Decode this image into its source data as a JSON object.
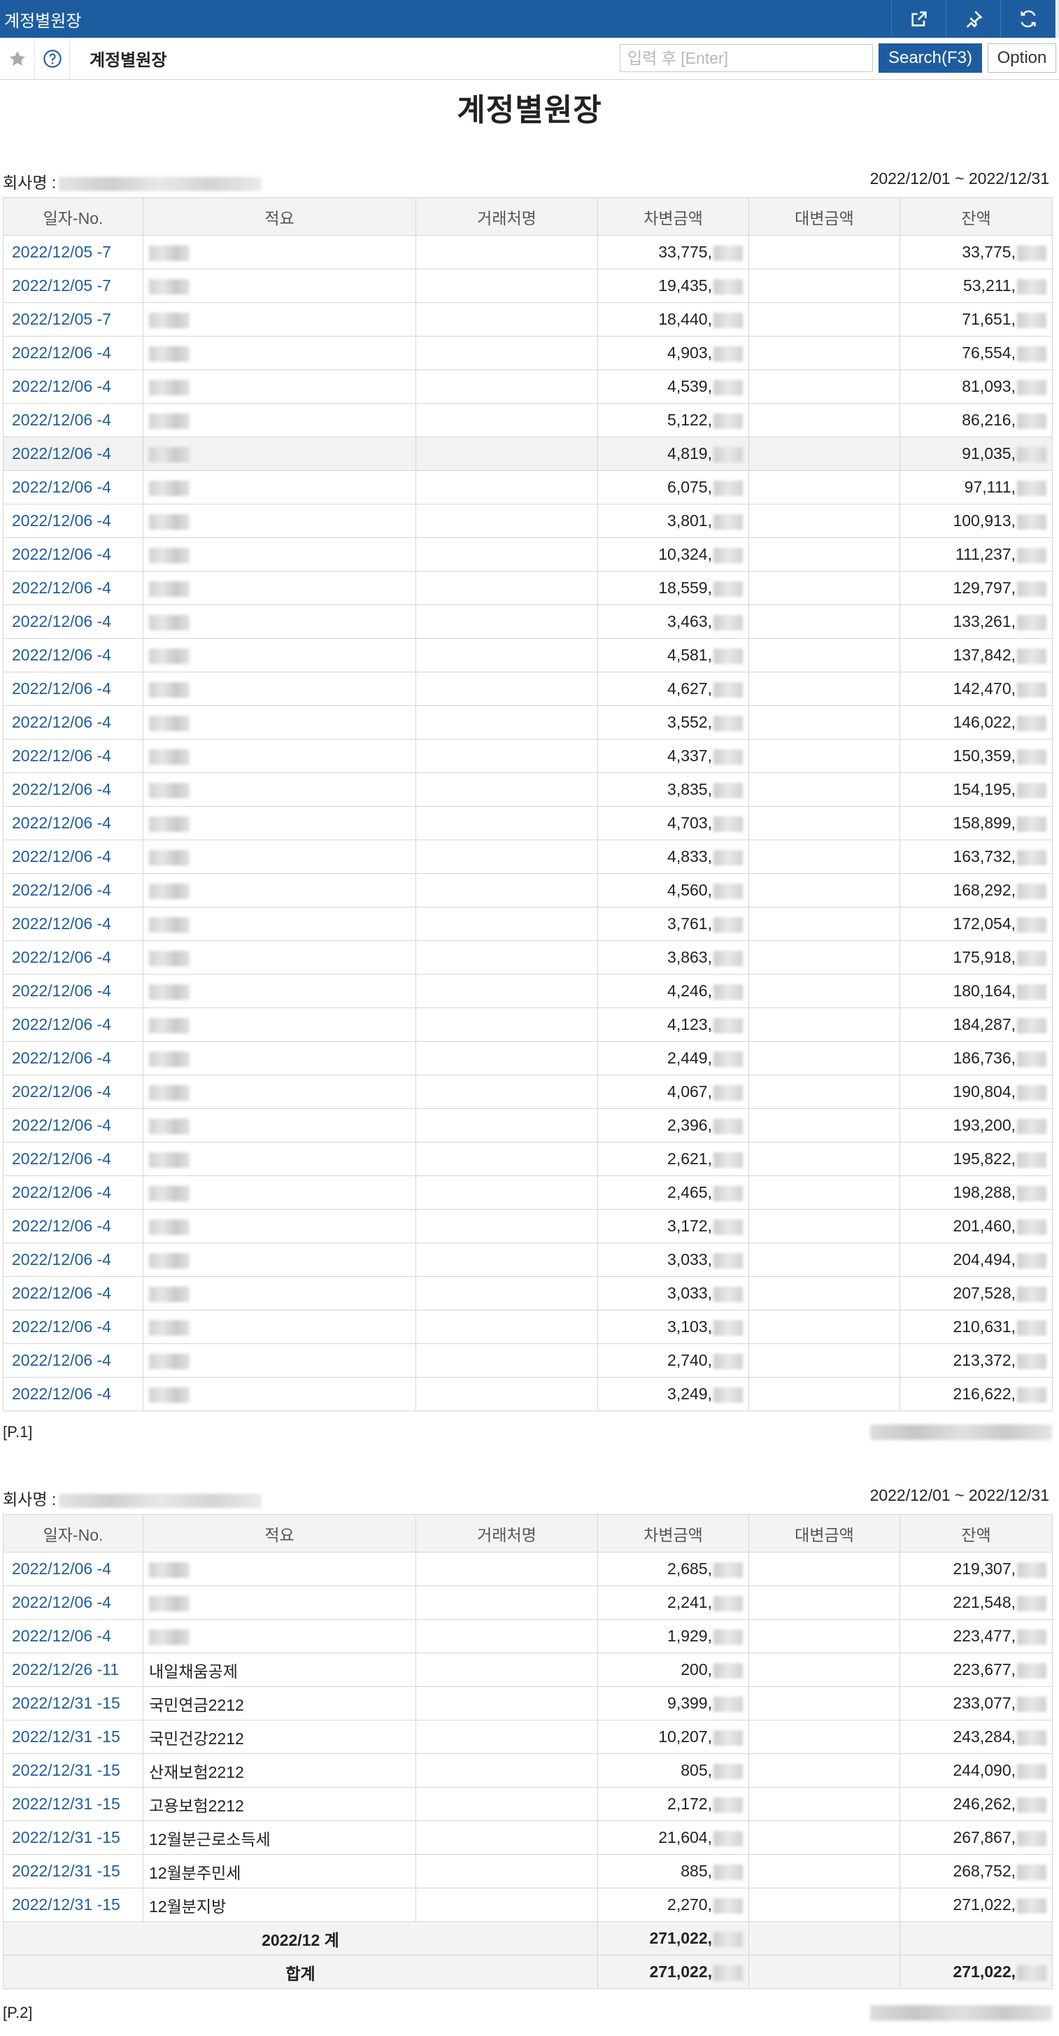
{
  "window": {
    "title": "계정별원장"
  },
  "toolbar": {
    "menu_title": "계정별원장",
    "search_placeholder": "입력 후 [Enter]",
    "search_label": "Search(F3)",
    "option_label": "Option"
  },
  "report": {
    "title": "계정별원장",
    "company_label": "회사명 :",
    "period": "2022/12/01 ~ 2022/12/31",
    "headers": [
      "일자-No.",
      "적요",
      "거래처명",
      "차변금액",
      "대변금액",
      "잔액"
    ]
  },
  "page1": {
    "footer": "[P.1]",
    "rows": [
      {
        "date": "2022/12/05 -7",
        "desc": "",
        "debit": "33,775,",
        "balance": "33,775,"
      },
      {
        "date": "2022/12/05 -7",
        "desc": "",
        "debit": "19,435,",
        "balance": "53,211,"
      },
      {
        "date": "2022/12/05 -7",
        "desc": "",
        "debit": "18,440,",
        "balance": "71,651,"
      },
      {
        "date": "2022/12/06 -4",
        "desc": "",
        "debit": "4,903,",
        "balance": "76,554,"
      },
      {
        "date": "2022/12/06 -4",
        "desc": "",
        "debit": "4,539,",
        "balance": "81,093,"
      },
      {
        "date": "2022/12/06 -4",
        "desc": "",
        "debit": "5,122,",
        "balance": "86,216,"
      },
      {
        "date": "2022/12/06 -4",
        "desc": "",
        "debit": "4,819,",
        "balance": "91,035,"
      },
      {
        "date": "2022/12/06 -4",
        "desc": "",
        "debit": "6,075,",
        "balance": "97,111,"
      },
      {
        "date": "2022/12/06 -4",
        "desc": "",
        "debit": "3,801,",
        "balance": "100,913,"
      },
      {
        "date": "2022/12/06 -4",
        "desc": "",
        "debit": "10,324,",
        "balance": "111,237,"
      },
      {
        "date": "2022/12/06 -4",
        "desc": "",
        "debit": "18,559,",
        "balance": "129,797,"
      },
      {
        "date": "2022/12/06 -4",
        "desc": "",
        "debit": "3,463,",
        "balance": "133,261,"
      },
      {
        "date": "2022/12/06 -4",
        "desc": "",
        "debit": "4,581,",
        "balance": "137,842,"
      },
      {
        "date": "2022/12/06 -4",
        "desc": "",
        "debit": "4,627,",
        "balance": "142,470,"
      },
      {
        "date": "2022/12/06 -4",
        "desc": "",
        "debit": "3,552,",
        "balance": "146,022,"
      },
      {
        "date": "2022/12/06 -4",
        "desc": "",
        "debit": "4,337,",
        "balance": "150,359,"
      },
      {
        "date": "2022/12/06 -4",
        "desc": "",
        "debit": "3,835,",
        "balance": "154,195,"
      },
      {
        "date": "2022/12/06 -4",
        "desc": "",
        "debit": "4,703,",
        "balance": "158,899,"
      },
      {
        "date": "2022/12/06 -4",
        "desc": "",
        "debit": "4,833,",
        "balance": "163,732,"
      },
      {
        "date": "2022/12/06 -4",
        "desc": "",
        "debit": "4,560,",
        "balance": "168,292,"
      },
      {
        "date": "2022/12/06 -4",
        "desc": "",
        "debit": "3,761,",
        "balance": "172,054,"
      },
      {
        "date": "2022/12/06 -4",
        "desc": "",
        "debit": "3,863,",
        "balance": "175,918,"
      },
      {
        "date": "2022/12/06 -4",
        "desc": "",
        "debit": "4,246,",
        "balance": "180,164,"
      },
      {
        "date": "2022/12/06 -4",
        "desc": "",
        "debit": "4,123,",
        "balance": "184,287,"
      },
      {
        "date": "2022/12/06 -4",
        "desc": "",
        "debit": "2,449,",
        "balance": "186,736,"
      },
      {
        "date": "2022/12/06 -4",
        "desc": "",
        "debit": "4,067,",
        "balance": "190,804,"
      },
      {
        "date": "2022/12/06 -4",
        "desc": "",
        "debit": "2,396,",
        "balance": "193,200,"
      },
      {
        "date": "2022/12/06 -4",
        "desc": "",
        "debit": "2,621,",
        "balance": "195,822,"
      },
      {
        "date": "2022/12/06 -4",
        "desc": "",
        "debit": "2,465,",
        "balance": "198,288,"
      },
      {
        "date": "2022/12/06 -4",
        "desc": "",
        "debit": "3,172,",
        "balance": "201,460,"
      },
      {
        "date": "2022/12/06 -4",
        "desc": "",
        "debit": "3,033,",
        "balance": "204,494,"
      },
      {
        "date": "2022/12/06 -4",
        "desc": "",
        "debit": "3,033,",
        "balance": "207,528,"
      },
      {
        "date": "2022/12/06 -4",
        "desc": "",
        "debit": "3,103,",
        "balance": "210,631,"
      },
      {
        "date": "2022/12/06 -4",
        "desc": "",
        "debit": "2,740,",
        "balance": "213,372,"
      },
      {
        "date": "2022/12/06 -4",
        "desc": "",
        "debit": "3,249,",
        "balance": "216,622,"
      }
    ]
  },
  "page2": {
    "footer": "[P.2]",
    "rows": [
      {
        "date": "2022/12/06 -4",
        "desc": "",
        "debit": "2,685,",
        "balance": "219,307,"
      },
      {
        "date": "2022/12/06 -4",
        "desc": "",
        "debit": "2,241,",
        "balance": "221,548,"
      },
      {
        "date": "2022/12/06 -4",
        "desc": "",
        "debit": "1,929,",
        "balance": "223,477,"
      },
      {
        "date": "2022/12/26 -11",
        "desc": "내일채움공제",
        "debit": "200,",
        "balance": "223,677,"
      },
      {
        "date": "2022/12/31 -15",
        "desc": "국민연금2212",
        "debit": "9,399,",
        "balance": "233,077,"
      },
      {
        "date": "2022/12/31 -15",
        "desc": "국민건강2212",
        "debit": "10,207,",
        "balance": "243,284,"
      },
      {
        "date": "2022/12/31 -15",
        "desc": "산재보험2212",
        "debit": "805,",
        "balance": "244,090,"
      },
      {
        "date": "2022/12/31 -15",
        "desc": "고용보험2212",
        "debit": "2,172,",
        "balance": "246,262,"
      },
      {
        "date": "2022/12/31 -15",
        "desc": "12월분근로소득세",
        "debit": "21,604,",
        "balance": "267,867,"
      },
      {
        "date": "2022/12/31 -15",
        "desc": "12월분주민세",
        "debit": "885,",
        "balance": "268,752,"
      },
      {
        "date": "2022/12/31 -15",
        "desc": "12월분지방",
        "debit": "2,270,",
        "balance": "271,022,"
      }
    ],
    "month_total": {
      "label": "2022/12 계",
      "debit": "271,022,",
      "balance": ""
    },
    "grand_total": {
      "label": "합계",
      "debit": "271,022,",
      "balance": "271,022,"
    }
  }
}
